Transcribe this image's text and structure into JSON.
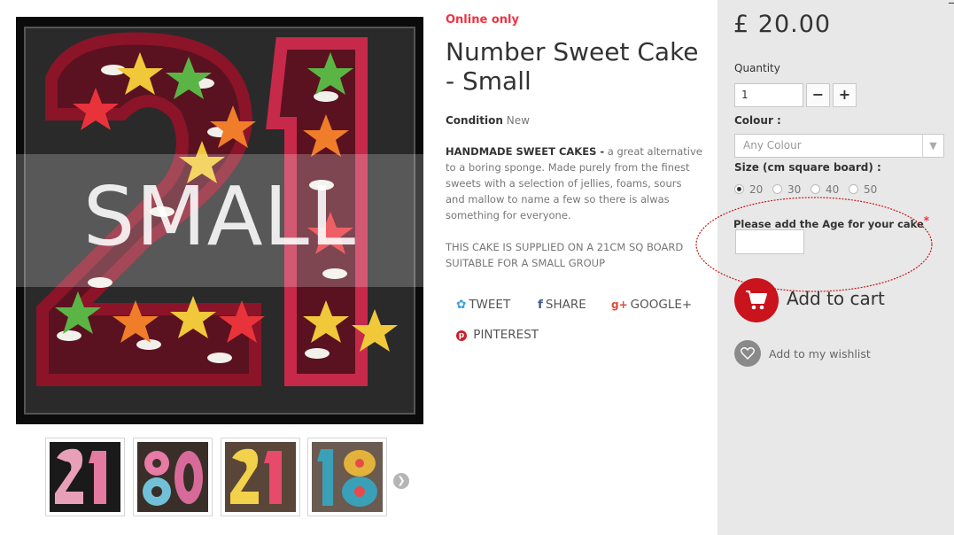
{
  "product": {
    "online_only": "Online only",
    "title": "Number Sweet Cake - Small",
    "condition_label": "Condition",
    "condition_value": "New",
    "desc_lead": "HANDMADE SWEET CAKES -",
    "desc_text": " a great alternative to a boring sponge.  Made purely from the finest sweets with a selection of jellies, foams, sours and mallow to name a few so there is alwas something for everyone.",
    "desc_note": "THIS CAKE IS SUPPLIED ON A 21CM SQ BOARD SUITABLE FOR A SMALL GROUP",
    "image_overlay_text": "SMALL"
  },
  "share": {
    "tweet": "TWEET",
    "facebook": "SHARE",
    "google": "GOOGLE+",
    "pinterest": "PINTEREST"
  },
  "thumbnails": [
    "21",
    "80",
    "21",
    "18"
  ],
  "purchase": {
    "price": "£ 20.00",
    "quantity_label": "Quantity",
    "quantity_value": "1",
    "colour_label": "Colour :",
    "colour_selected": "Any Colour",
    "size_label": "Size (cm square board) :",
    "sizes": [
      "20",
      "30",
      "40",
      "50"
    ],
    "size_selected": "20",
    "age_label": "Please add the Age for your cake",
    "age_required": "*",
    "add_to_cart": "Add to cart",
    "wishlist": "Add to my wishlist"
  },
  "colors": {
    "accent_red": "#f13340",
    "cart_red": "#c9131d",
    "panel_bg": "#e8e8e8"
  }
}
